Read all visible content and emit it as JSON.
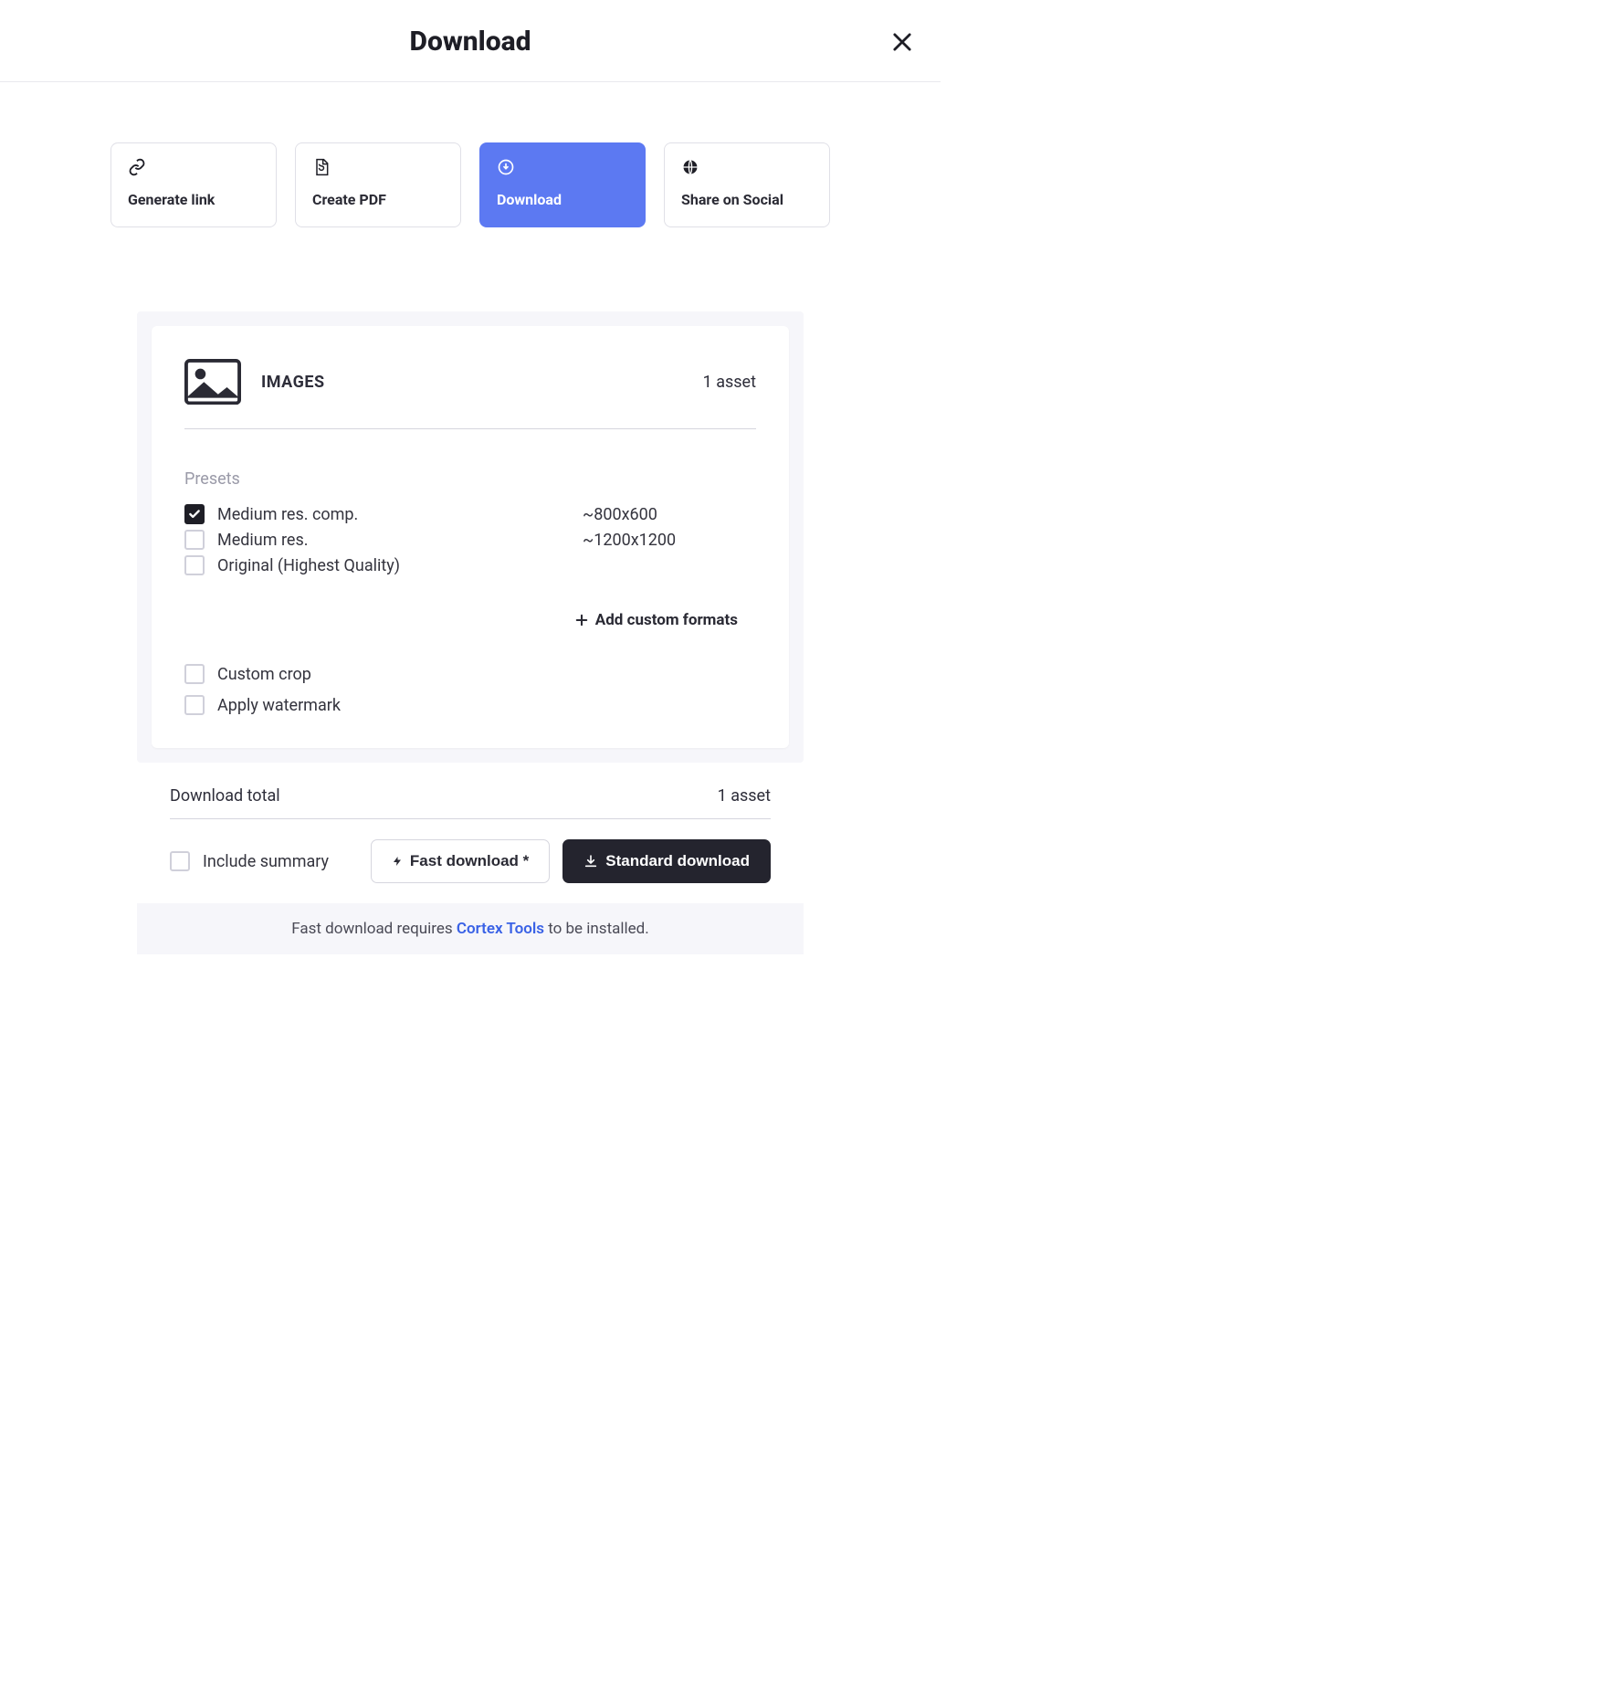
{
  "header": {
    "title": "Download"
  },
  "tabs": [
    {
      "label": "Generate link"
    },
    {
      "label": "Create PDF"
    },
    {
      "label": "Download"
    },
    {
      "label": "Share on Social"
    }
  ],
  "panel": {
    "section_title": "IMAGES",
    "asset_count": "1 asset",
    "presets_label": "Presets",
    "presets": [
      {
        "name": "Medium res. comp.",
        "dim": "~800x600",
        "checked": true
      },
      {
        "name": "Medium res.",
        "dim": "~1200x1200",
        "checked": false
      },
      {
        "name": "Original (Highest Quality)",
        "dim": "",
        "checked": false
      }
    ],
    "add_custom": "Add custom formats",
    "options": {
      "custom_crop": "Custom crop",
      "apply_watermark": "Apply watermark"
    }
  },
  "totals": {
    "label": "Download total",
    "value": "1 asset"
  },
  "actions": {
    "include_summary": "Include summary",
    "fast_download": "Fast download *",
    "standard_download": "Standard download"
  },
  "footnote": {
    "prefix": "Fast download requires ",
    "link": "Cortex Tools",
    "suffix": " to be installed."
  }
}
